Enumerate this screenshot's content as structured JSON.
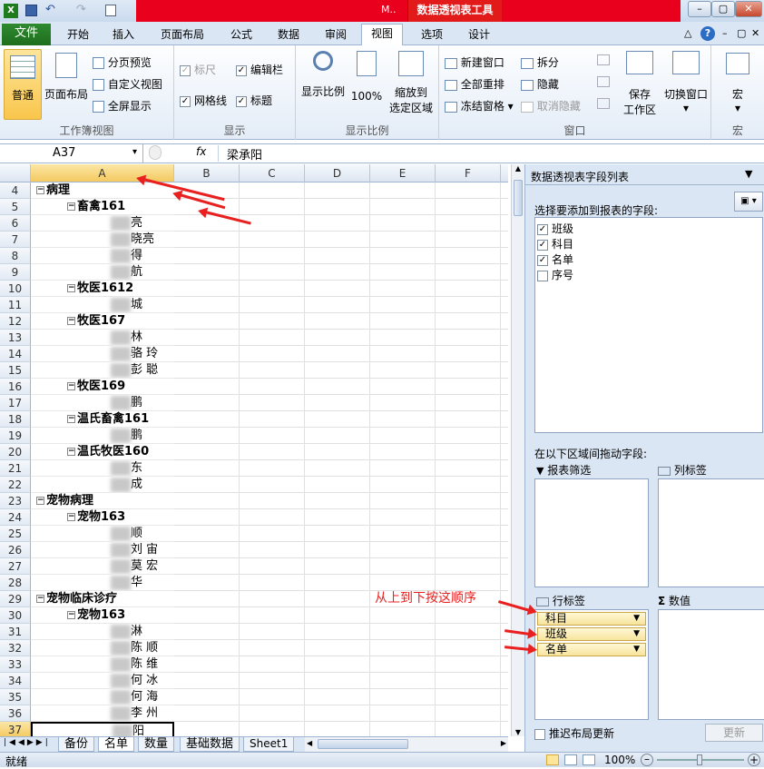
{
  "window": {
    "title_fragment": "M..",
    "context_tab": "数据透视表工具"
  },
  "tabs": {
    "file": "文件",
    "items": [
      "开始",
      "插入",
      "页面布局",
      "公式",
      "数据",
      "审阅",
      "视图",
      "选项",
      "设计"
    ]
  },
  "ribbon": {
    "workbook_views": {
      "label": "工作簿视图",
      "normal": "普通",
      "page_layout": "页面布局",
      "page_break": "分页预览",
      "custom": "自定义视图",
      "fullscreen": "全屏显示"
    },
    "show": {
      "label": "显示",
      "ruler": "标尺",
      "formula_bar": "编辑栏",
      "gridlines": "网格线",
      "headings": "标题"
    },
    "zoom": {
      "label": "显示比例",
      "zoom": "显示比例",
      "hundred": "100%",
      "to_selection_line1": "缩放到",
      "to_selection_line2": "选定区域"
    },
    "window": {
      "label": "窗口",
      "new_window": "新建窗口",
      "arrange_all": "全部重排",
      "freeze": "冻结窗格",
      "split": "拆分",
      "hide": "隐藏",
      "unhide": "取消隐藏",
      "save_ws_line1": "保存",
      "save_ws_line2": "工作区",
      "switch": "切换窗口"
    },
    "macros": {
      "label": "宏",
      "macros": "宏"
    }
  },
  "formula_bar": {
    "name_box": "A37",
    "fx": "fx",
    "value": "梁承阳"
  },
  "grid": {
    "columns": [
      "A",
      "B",
      "C",
      "D",
      "E",
      "F"
    ],
    "rows": [
      {
        "num": "4",
        "level": 0,
        "text": "病理"
      },
      {
        "num": "5",
        "level": 1,
        "text": "畜禽161"
      },
      {
        "num": "6",
        "level": 2,
        "text": "亮"
      },
      {
        "num": "7",
        "level": 2,
        "text": "晓亮"
      },
      {
        "num": "8",
        "level": 2,
        "text": "得"
      },
      {
        "num": "9",
        "level": 2,
        "text": "航"
      },
      {
        "num": "10",
        "level": 1,
        "text": "牧医1612"
      },
      {
        "num": "11",
        "level": 2,
        "text": "城"
      },
      {
        "num": "12",
        "level": 1,
        "text": "牧医167"
      },
      {
        "num": "13",
        "level": 2,
        "text": "林"
      },
      {
        "num": "14",
        "level": 2,
        "text": "骆 玲"
      },
      {
        "num": "15",
        "level": 2,
        "text": "彭 聪"
      },
      {
        "num": "16",
        "level": 1,
        "text": "牧医169"
      },
      {
        "num": "17",
        "level": 2,
        "text": "鹏"
      },
      {
        "num": "18",
        "level": 1,
        "text": "温氏畜禽161"
      },
      {
        "num": "19",
        "level": 2,
        "text": "鹏"
      },
      {
        "num": "20",
        "level": 1,
        "text": "温氏牧医160"
      },
      {
        "num": "21",
        "level": 2,
        "text": "东"
      },
      {
        "num": "22",
        "level": 2,
        "text": "成"
      },
      {
        "num": "23",
        "level": 0,
        "text": "宠物病理"
      },
      {
        "num": "24",
        "level": 1,
        "text": "宠物163"
      },
      {
        "num": "25",
        "level": 2,
        "text": "顺"
      },
      {
        "num": "26",
        "level": 2,
        "text": "刘 宙"
      },
      {
        "num": "27",
        "level": 2,
        "text": "莫 宏"
      },
      {
        "num": "28",
        "level": 2,
        "text": "华"
      },
      {
        "num": "29",
        "level": 0,
        "text": "宠物临床诊疗"
      },
      {
        "num": "30",
        "level": 1,
        "text": "宠物163"
      },
      {
        "num": "31",
        "level": 2,
        "text": "淋"
      },
      {
        "num": "32",
        "level": 2,
        "text": "陈 顺"
      },
      {
        "num": "33",
        "level": 2,
        "text": "陈 维"
      },
      {
        "num": "34",
        "level": 2,
        "text": "何 冰"
      },
      {
        "num": "35",
        "level": 2,
        "text": "何 海"
      },
      {
        "num": "36",
        "level": 2,
        "text": "李 州"
      },
      {
        "num": "37",
        "level": 2,
        "text": "阳"
      }
    ]
  },
  "sheet_tabs": [
    "备份",
    "名单",
    "数量",
    "基础数据",
    "Sheet1"
  ],
  "status": {
    "ready": "就绪",
    "zoom": "100%"
  },
  "pivot_pane": {
    "title": "数据透视表字段列表",
    "choose_label": "选择要添加到报表的字段:",
    "fields": [
      {
        "name": "班级",
        "checked": "✓"
      },
      {
        "name": "科目",
        "checked": "✓"
      },
      {
        "name": "名单",
        "checked": "✓"
      },
      {
        "name": "序号",
        "checked": ""
      }
    ],
    "drag_label": "在以下区域间拖动字段:",
    "report_filter": "报表筛选",
    "column_labels": "列标签",
    "row_labels": "行标签",
    "values": "数值",
    "row_items": [
      "科目",
      "班级",
      "名单"
    ],
    "defer": "推迟布局更新",
    "update": "更新"
  },
  "annotation": {
    "note": "从上到下按这顺序"
  },
  "colors": {
    "accent_red": "#e82020",
    "file_tab": "#1e6d1e",
    "chip": "#f7e49c"
  }
}
